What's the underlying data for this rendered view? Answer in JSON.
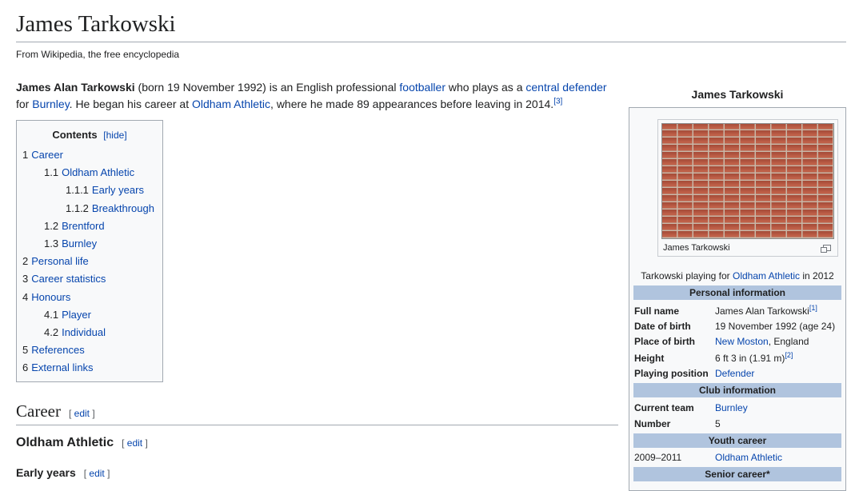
{
  "page": {
    "title": "James Tarkowski",
    "tagline": "From Wikipedia, the free encyclopedia"
  },
  "lead": {
    "name_bold": "James Alan Tarkowski",
    "t1": " (born 19 November 1992) is an English professional ",
    "link_footballer": "footballer",
    "t2": " who plays as a ",
    "link_central_defender": "central defender",
    "t3": " for ",
    "link_burnley": "Burnley",
    "t4": ". He began his career at ",
    "link_oldham": "Oldham Athletic",
    "t5": ", where he made 89 appearances before leaving in 2014.",
    "ref": "[3]"
  },
  "toc": {
    "title": "Contents",
    "hide_label": "[hide]",
    "items": [
      {
        "num": "1",
        "label": "Career"
      },
      {
        "num": "1.1",
        "label": "Oldham Athletic"
      },
      {
        "num": "1.1.1",
        "label": "Early years"
      },
      {
        "num": "1.1.2",
        "label": "Breakthrough"
      },
      {
        "num": "1.2",
        "label": "Brentford"
      },
      {
        "num": "1.3",
        "label": "Burnley"
      },
      {
        "num": "2",
        "label": "Personal life"
      },
      {
        "num": "3",
        "label": "Career statistics"
      },
      {
        "num": "4",
        "label": "Honours"
      },
      {
        "num": "4.1",
        "label": "Player"
      },
      {
        "num": "4.2",
        "label": "Individual"
      },
      {
        "num": "5",
        "label": "References"
      },
      {
        "num": "6",
        "label": "External links"
      }
    ]
  },
  "sections": {
    "career": "Career",
    "oldham": "Oldham Athletic",
    "early_years": "Early years",
    "edit_open": "[ ",
    "edit_label": "edit",
    "edit_close": " ]"
  },
  "infobox": {
    "title": "James Tarkowski",
    "thumb_caption": "James Tarkowski",
    "image_caption_pre": "Tarkowski playing for ",
    "image_caption_link": "Oldham Athletic",
    "image_caption_post": " in 2012",
    "personal_header": "Personal information",
    "full_name_label": "Full name",
    "full_name": "James Alan Tarkowski",
    "full_name_ref": "[1]",
    "dob_label": "Date of birth",
    "dob": "19 November 1992 (age 24)",
    "pob_label": "Place of birth",
    "pob_link": "New Moston",
    "pob_rest": ", England",
    "height_label": "Height",
    "height": "6 ft 3 in (1.91 m)",
    "height_ref": "[2]",
    "position_label": "Playing position",
    "position": "Defender",
    "club_header": "Club information",
    "team_label": "Current team",
    "team": "Burnley",
    "number_label": "Number",
    "number": "5",
    "youth_header": "Youth career",
    "youth_years": "2009–2011",
    "youth_club": "Oldham Athletic",
    "senior_header": "Senior career*"
  },
  "colors": {
    "link": "#0645ad",
    "infobox_header_bg": "#b0c4de",
    "border": "#a2a9b1"
  }
}
